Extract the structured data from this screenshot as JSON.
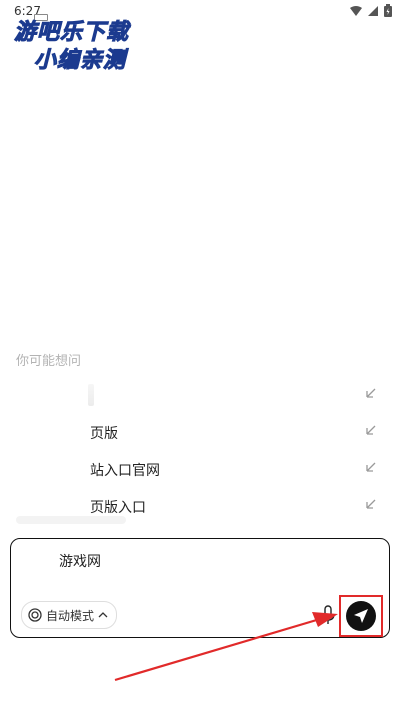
{
  "status": {
    "time": "6:27"
  },
  "watermark": {
    "line1": "游吧乐下载",
    "line2": "小编亲测"
  },
  "suggestions": {
    "title": "你可能想问",
    "items": [
      {
        "label": ""
      },
      {
        "label": "页版"
      },
      {
        "label": "站入口官网"
      },
      {
        "label": "页版入口"
      }
    ]
  },
  "input": {
    "value": "游戏网",
    "mode_label": "自动模式"
  },
  "colors": {
    "accent": "#111111",
    "annotation": "#e12a2a",
    "hint": "#b3b3b3"
  },
  "icons": [
    "wifi-icon",
    "signal-icon",
    "battery-icon",
    "arrow-up-left-icon",
    "mode-icon",
    "chevron-up-icon",
    "microphone-icon",
    "send-icon"
  ]
}
